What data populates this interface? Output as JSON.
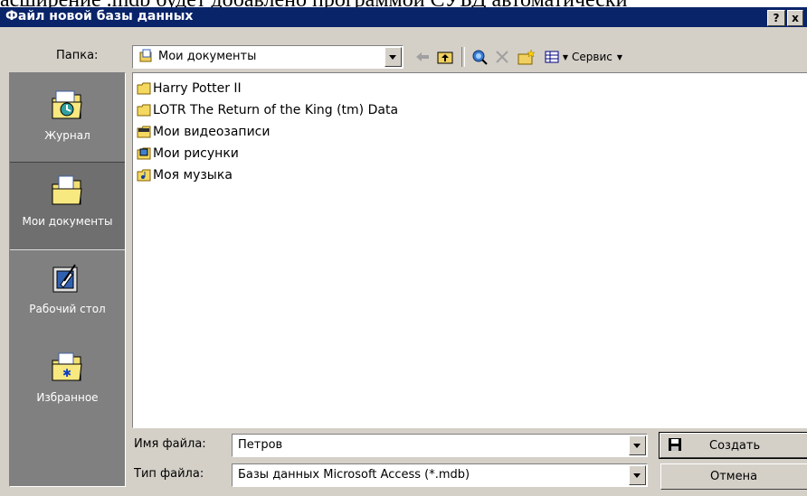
{
  "background_text": "асширение  .mdb  будет добавлено программой  СУБД  автоматически",
  "window": {
    "title": "Файл новой базы данных",
    "help": "?",
    "close": "x"
  },
  "folder_label": "Папка:",
  "folder_value": "Мои документы",
  "toolbar": {
    "service_label": "Сервис"
  },
  "places": [
    {
      "label": "Журнал",
      "icon": "history-icon"
    },
    {
      "label": "Мои документы",
      "icon": "my-documents-icon"
    },
    {
      "label": "Рабочий стол",
      "icon": "desktop-icon"
    },
    {
      "label": "Избранное",
      "icon": "favorites-icon"
    }
  ],
  "files": [
    {
      "name": "Harry Potter II",
      "icon": "folder-icon"
    },
    {
      "name": "LOTR The Return of the King (tm) Data",
      "icon": "folder-icon"
    },
    {
      "name": "Мои видеозаписи",
      "icon": "video-folder-icon"
    },
    {
      "name": "Мои рисунки",
      "icon": "pictures-folder-icon"
    },
    {
      "name": "Моя музыка",
      "icon": "music-folder-icon"
    }
  ],
  "filename": {
    "label": "Имя файла:",
    "value": "Петров"
  },
  "filetype": {
    "label": "Тип файла:",
    "value": "Базы данных Microsoft Access (*.mdb)"
  },
  "buttons": {
    "create": "Создать",
    "cancel": "Отмена"
  }
}
